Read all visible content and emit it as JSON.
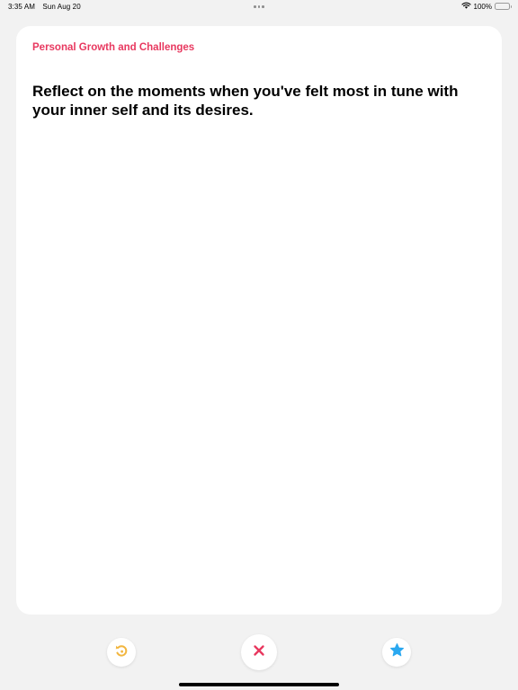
{
  "status_bar": {
    "time": "3:35 AM",
    "date": "Sun Aug 20",
    "battery_percent": "100%",
    "battery_level": 1.0
  },
  "card": {
    "category": "Personal Growth and Challenges",
    "prompt": "Reflect on the moments when you've felt most in tune with your inner self and its desires."
  },
  "actions": {
    "undo_icon": "undo-icon",
    "dismiss_icon": "close-icon",
    "favorite_icon": "star-icon"
  },
  "colors": {
    "category": "#e8385f",
    "undo": "#f2b640",
    "dismiss": "#e8385f",
    "favorite": "#2aa8f0",
    "background": "#f2f2f2",
    "card": "#ffffff"
  }
}
